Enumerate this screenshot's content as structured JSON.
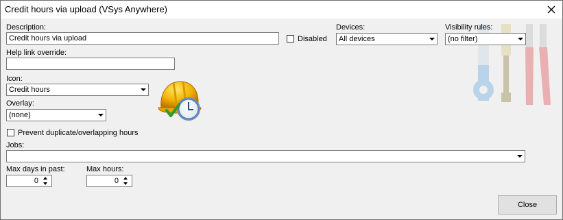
{
  "window": {
    "title": "Credit hours via upload (VSys Anywhere)"
  },
  "form": {
    "description_label": "Description:",
    "description_value": "Credit hours via upload",
    "disabled_label": "Disabled",
    "disabled_checked": false,
    "devices_label": "Devices:",
    "devices_value": "All devices",
    "visibility_label": "Visibility rules:",
    "visibility_value": "(no filter)",
    "help_link_label": "Help link override:",
    "help_link_value": "",
    "icon_label": "Icon:",
    "icon_value": "Credit hours",
    "overlay_label": "Overlay:",
    "overlay_value": "(none)",
    "prevent_duplicate_label": "Prevent duplicate/overlapping hours",
    "prevent_duplicate_checked": false,
    "jobs_label": "Jobs:",
    "jobs_value": "",
    "max_days_label": "Max days in past:",
    "max_days_value": "0",
    "max_hours_label": "Max hours:",
    "max_hours_value": "0"
  },
  "buttons": {
    "close_label": "Close"
  },
  "icons": {
    "close": "close-icon",
    "preview": "hardhat-clock-icon",
    "tools_watermark": "tools-watermark-icon"
  }
}
